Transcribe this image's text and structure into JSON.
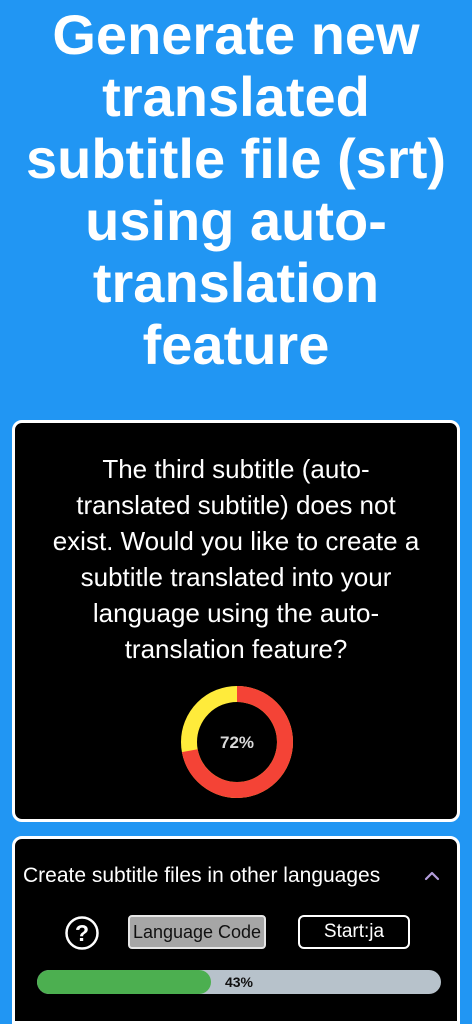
{
  "header": {
    "title_lines": [
      "Generate new",
      "translated",
      "subtitle file (srt)",
      "using auto-",
      "translation",
      "feature"
    ]
  },
  "dialog": {
    "message_lines": [
      "The third subtitle (auto-",
      "translated subtitle) does not",
      "exist. Would you like to create a",
      "subtitle translated into your",
      "language using the auto-",
      "translation feature?"
    ],
    "donut": {
      "label": "72%",
      "value": 0.72,
      "fill_color": "#f44336",
      "rest_color": "#ffeb3b"
    }
  },
  "language_panel": {
    "title": "Create subtitle files in other languages",
    "chevron_icon": "chevron-up-icon",
    "help_icon": "question-circle-icon",
    "language_code_label": "Language Code",
    "start_label": "Start:ja",
    "progress": {
      "label": "43%",
      "value": 0.43,
      "fill_color": "#4caf50"
    }
  },
  "colors": {
    "background": "#2196f3",
    "panel": "#000000",
    "border": "#ffffff",
    "accent": "#b39ddb"
  }
}
